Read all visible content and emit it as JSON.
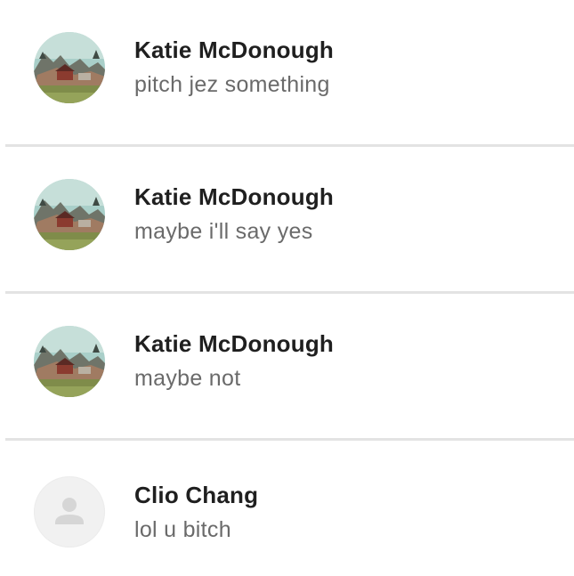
{
  "conversations": [
    {
      "sender": "Katie McDonough",
      "message": "pitch jez something",
      "avatar": "photo-avatar"
    },
    {
      "sender": "Katie McDonough",
      "message": "maybe i'll say yes",
      "avatar": "photo-avatar"
    },
    {
      "sender": "Katie McDonough",
      "message": "maybe not",
      "avatar": "photo-avatar"
    },
    {
      "sender": "Clio Chang",
      "message": "lol u bitch",
      "avatar": "default-person-icon"
    }
  ],
  "colors": {
    "name": "#1f1f1f",
    "message": "#6a6a6a",
    "divider": "#e3e3e3",
    "placeholder_avatar_bg": "#f1f1f1",
    "placeholder_avatar_icon": "#d6d6d6"
  }
}
